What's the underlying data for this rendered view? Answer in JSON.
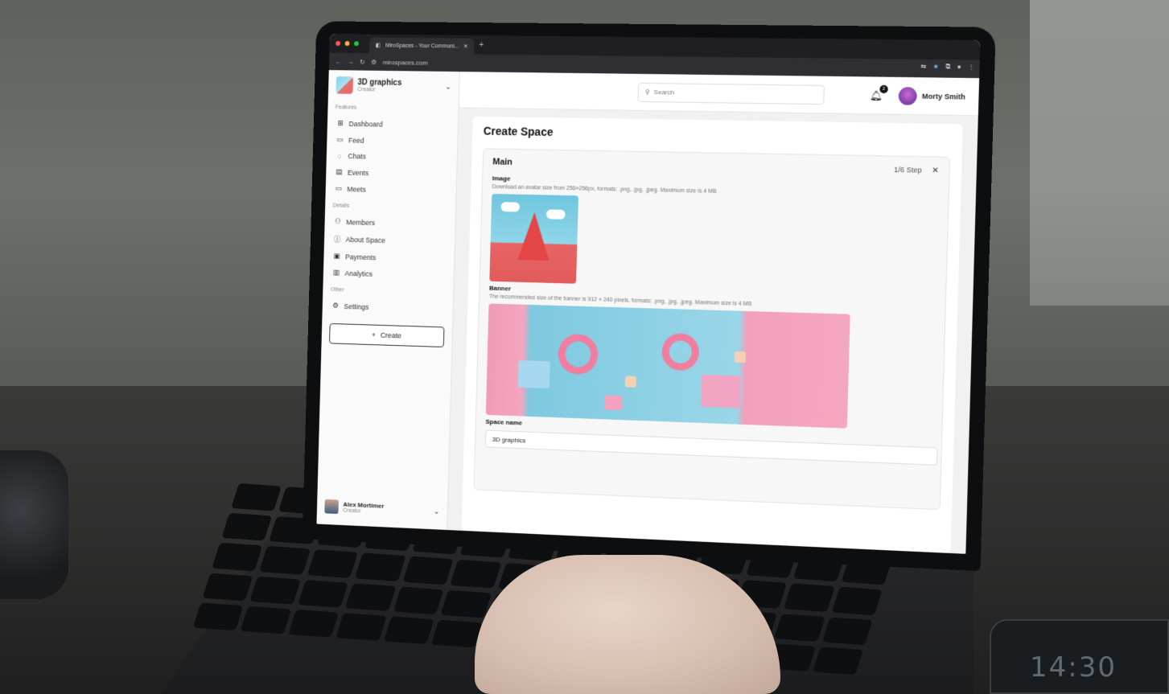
{
  "browser": {
    "tab_title": "MiroSpaces - Your Communi...",
    "url": "mirospaces.com"
  },
  "sidebar": {
    "space_name": "3D graphics",
    "space_role": "Creator",
    "section_features": "Features",
    "section_details": "Details",
    "section_other": "Other",
    "items": [
      {
        "label": "Dashboard",
        "icon": "grid-icon"
      },
      {
        "label": "Feed",
        "icon": "feed-icon"
      },
      {
        "label": "Chats",
        "icon": "chat-icon"
      },
      {
        "label": "Events",
        "icon": "calendar-icon"
      },
      {
        "label": "Meets",
        "icon": "video-icon"
      },
      {
        "label": "Members",
        "icon": "members-icon"
      },
      {
        "label": "About Space",
        "icon": "info-icon"
      },
      {
        "label": "Payments",
        "icon": "card-icon"
      },
      {
        "label": "Analytics",
        "icon": "analytics-icon"
      },
      {
        "label": "Settings",
        "icon": "gear-icon"
      }
    ],
    "create_label": "Create",
    "user_name": "Alex Mortimer",
    "user_role": "Creator"
  },
  "topbar": {
    "search_placeholder": "Search",
    "notification_count": "2",
    "user_name": "Morty Smith"
  },
  "page": {
    "title": "Create Space",
    "section_title": "Main",
    "step": "1/6 Step",
    "image_label": "Image",
    "image_hint": "Download an avatar size from 256×256px, formats: .png, .jpg, .jpeg. Maximum size is 4 MB",
    "banner_label": "Banner",
    "banner_hint": "The recommended size of the banner is 912 × 240 pixels, formats: .png, .jpg, .jpeg. Maximum size is 4 MB",
    "space_name_label": "Space name",
    "space_name_value": "3D graphics"
  },
  "scene": {
    "phone_time": "14:30"
  }
}
